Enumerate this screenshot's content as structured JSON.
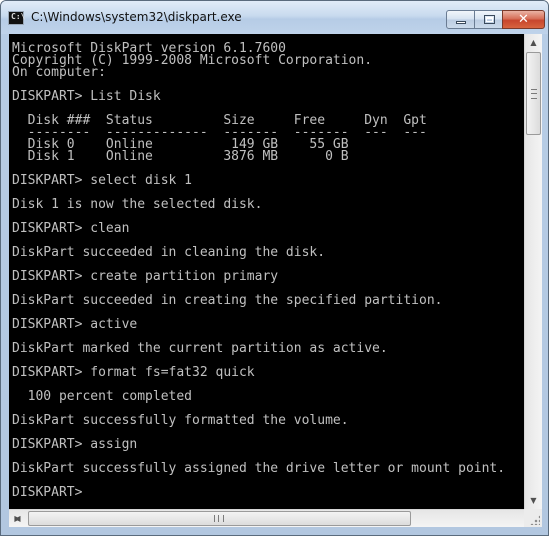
{
  "window": {
    "title": "C:\\Windows\\system32\\diskpart.exe",
    "icon": "console-icon",
    "buttons": {
      "minimize": "minimize-icon",
      "maximize": "maximize-icon",
      "close": "close-icon",
      "close_glyph": "✕"
    }
  },
  "console": {
    "background": "#000000",
    "foreground": "#c0c0c0",
    "lines": [
      "Microsoft DiskPart version 6.1.7600",
      "Copyright (C) 1999-2008 Microsoft Corporation.",
      "On computer:",
      "",
      "DISKPART> List Disk",
      "",
      "  Disk ###  Status         Size     Free     Dyn  Gpt",
      "  --------  -------------  -------  -------  ---  ---",
      "  Disk 0    Online          149 GB    55 GB",
      "  Disk 1    Online         3876 MB      0 B",
      "",
      "DISKPART> select disk 1",
      "",
      "Disk 1 is now the selected disk.",
      "",
      "DISKPART> clean",
      "",
      "DiskPart succeeded in cleaning the disk.",
      "",
      "DISKPART> create partition primary",
      "",
      "DiskPart succeeded in creating the specified partition.",
      "",
      "DISKPART> active",
      "",
      "DiskPart marked the current partition as active.",
      "",
      "DISKPART> format fs=fat32 quick",
      "",
      "  100 percent completed",
      "",
      "DiskPart successfully formatted the volume.",
      "",
      "DISKPART> assign",
      "",
      "DiskPart successfully assigned the drive letter or mount point.",
      "",
      "DISKPART> "
    ]
  },
  "scrollbars": {
    "vertical": {
      "up": "▲",
      "down": "▼"
    },
    "horizontal": {
      "left": "◀",
      "right": "▶"
    }
  }
}
